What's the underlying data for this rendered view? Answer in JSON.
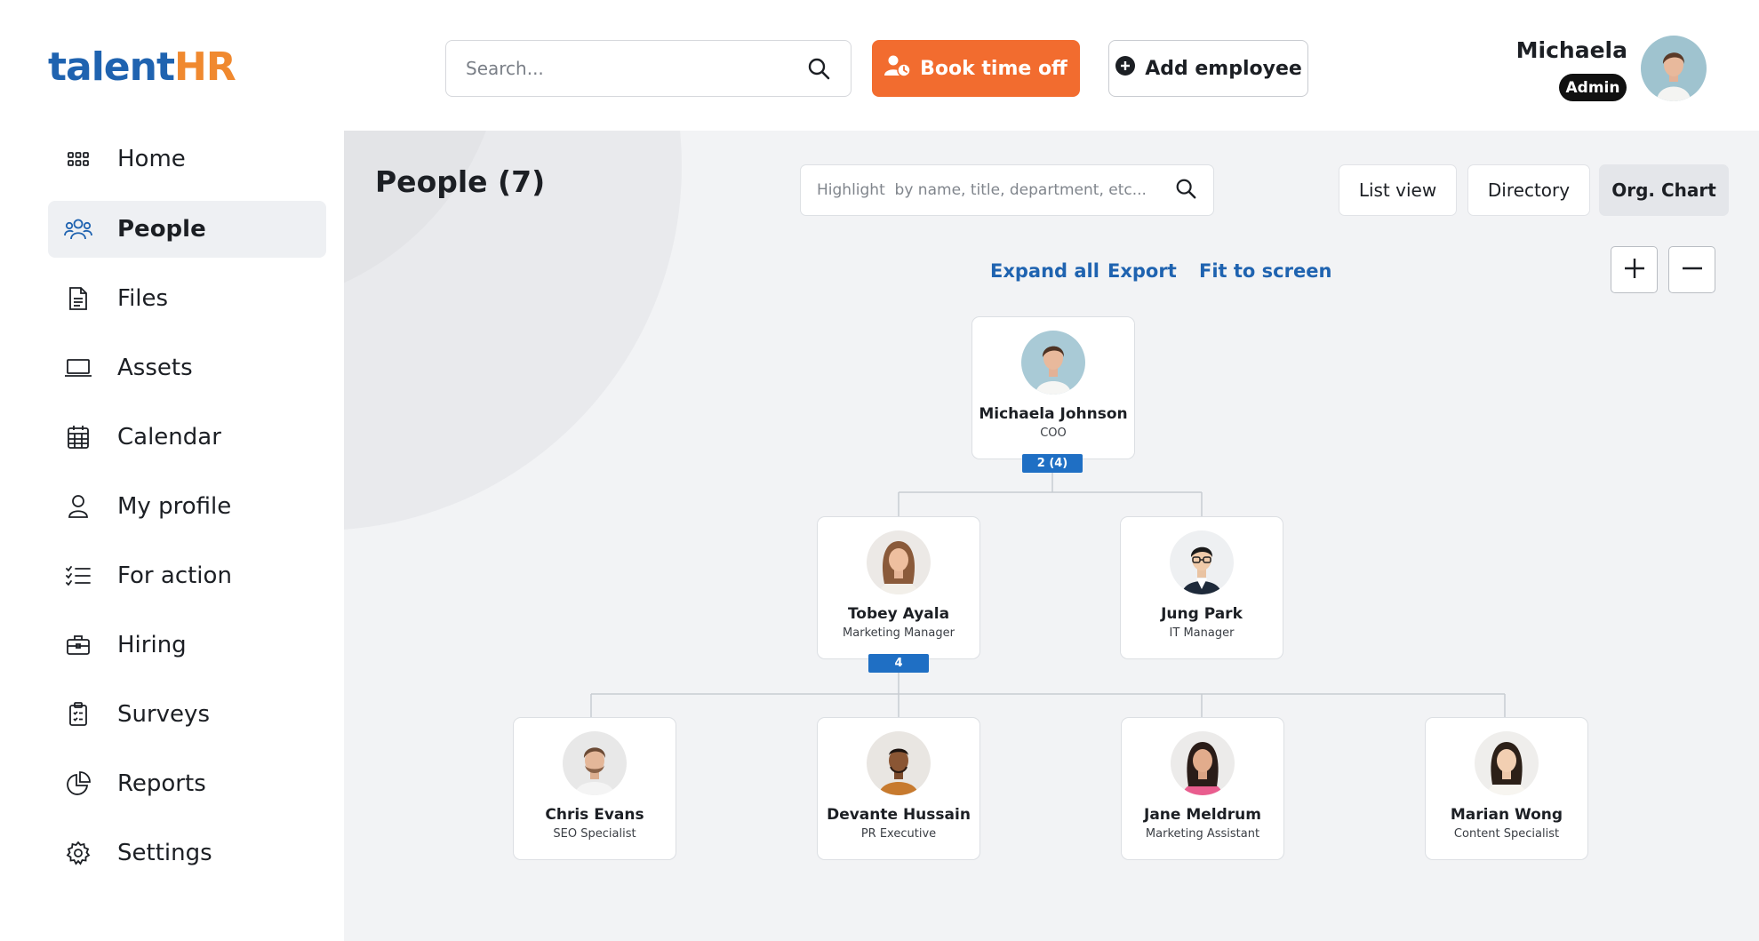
{
  "logo": {
    "part1": "talent",
    "part2": "HR"
  },
  "search": {
    "placeholder": "Search..."
  },
  "header": {
    "book_label": "Book time off",
    "add_label": "Add employee"
  },
  "user": {
    "name": "Michaela",
    "role": "Admin"
  },
  "sidebar": {
    "items": [
      {
        "label": "Home",
        "icon": "grid-icon"
      },
      {
        "label": "People",
        "icon": "people-icon",
        "active": true
      },
      {
        "label": "Files",
        "icon": "file-icon"
      },
      {
        "label": "Assets",
        "icon": "laptop-icon"
      },
      {
        "label": "Calendar",
        "icon": "calendar-icon"
      },
      {
        "label": "My profile",
        "icon": "user-icon"
      },
      {
        "label": "For action",
        "icon": "checklist-icon"
      },
      {
        "label": "Hiring",
        "icon": "briefcase-icon"
      },
      {
        "label": "Surveys",
        "icon": "clipboard-icon"
      },
      {
        "label": "Reports",
        "icon": "pie-chart-icon"
      },
      {
        "label": "Settings",
        "icon": "gear-icon"
      }
    ]
  },
  "main": {
    "title": "People (7)",
    "highlight_placeholder": "Highlight  by name, title, department, etc...",
    "views": {
      "list": "List view",
      "directory": "Directory",
      "org": "Org. Chart"
    },
    "links": {
      "expand": "Expand all",
      "export": "Export",
      "fit": "Fit to screen"
    }
  },
  "org": {
    "root": {
      "name": "Michaela Johnson",
      "title": "COO",
      "badge": "2 (4)"
    },
    "level2": [
      {
        "name": "Tobey Ayala",
        "title": "Marketing Manager",
        "badge": "4"
      },
      {
        "name": "Jung Park",
        "title": "IT Manager"
      }
    ],
    "level3": [
      {
        "name": "Chris Evans",
        "title": "SEO Specialist"
      },
      {
        "name": "Devante Hussain",
        "title": "PR Executive"
      },
      {
        "name": "Jane Meldrum",
        "title": "Marketing Assistant"
      },
      {
        "name": "Marian Wong",
        "title": "Content Specialist"
      }
    ]
  },
  "colors": {
    "brand_blue": "#1f63b0",
    "brand_orange": "#f26c2f",
    "badge_blue": "#1f6fc4"
  }
}
